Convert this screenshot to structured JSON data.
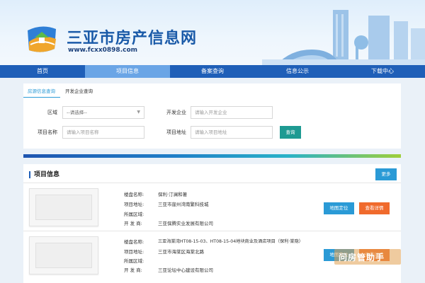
{
  "header": {
    "site_title": "三亚市房产信息网",
    "site_url": "www.fcxx0898.com"
  },
  "nav": {
    "items": [
      "首页",
      "项目信息",
      "备案查询",
      "信息公示",
      "下载中心"
    ],
    "active_index": 1
  },
  "search": {
    "tabs": [
      "房源信息查询",
      "开发企业查询"
    ],
    "area_label": "区域",
    "area_value": "--请选择--",
    "developer_label": "开发企业",
    "developer_placeholder": "请输入开发企业",
    "project_name_label": "项目名称",
    "project_name_placeholder": "请输入项目名称",
    "project_address_label": "项目地址",
    "project_address_placeholder": "请输入项目地址",
    "query_button": "查询"
  },
  "projects": {
    "title": "项目信息",
    "more_button": "更多",
    "field_labels": {
      "name": "楼盘名称:",
      "address": "项目地址:",
      "district": "所属区域:",
      "developer": "开 发 商:"
    },
    "map_button": "地图定位",
    "detail_button": "查看详情",
    "items": [
      {
        "name": "保利·汀澜和著",
        "address": "三亚市崖州湾南繁科技城",
        "district": "",
        "developer": "三亚保腾实业发展有限公司"
      },
      {
        "name": "三亚海棠湾HT08-15-03、HT08-15-04地块商业及酒店项目（保利·棠隐）",
        "address": "三亚市海棠区海棠北路",
        "district": "",
        "developer": "三亚论坛中心建设有限公司"
      }
    ]
  },
  "watermark": "问房管助手",
  "colors": {
    "nav_bg": "#1f5fb8",
    "nav_active": "#6aa5e6",
    "query_btn": "#1e9a92",
    "map_btn": "#2a9ad6",
    "detail_btn": "#f06a2c"
  }
}
